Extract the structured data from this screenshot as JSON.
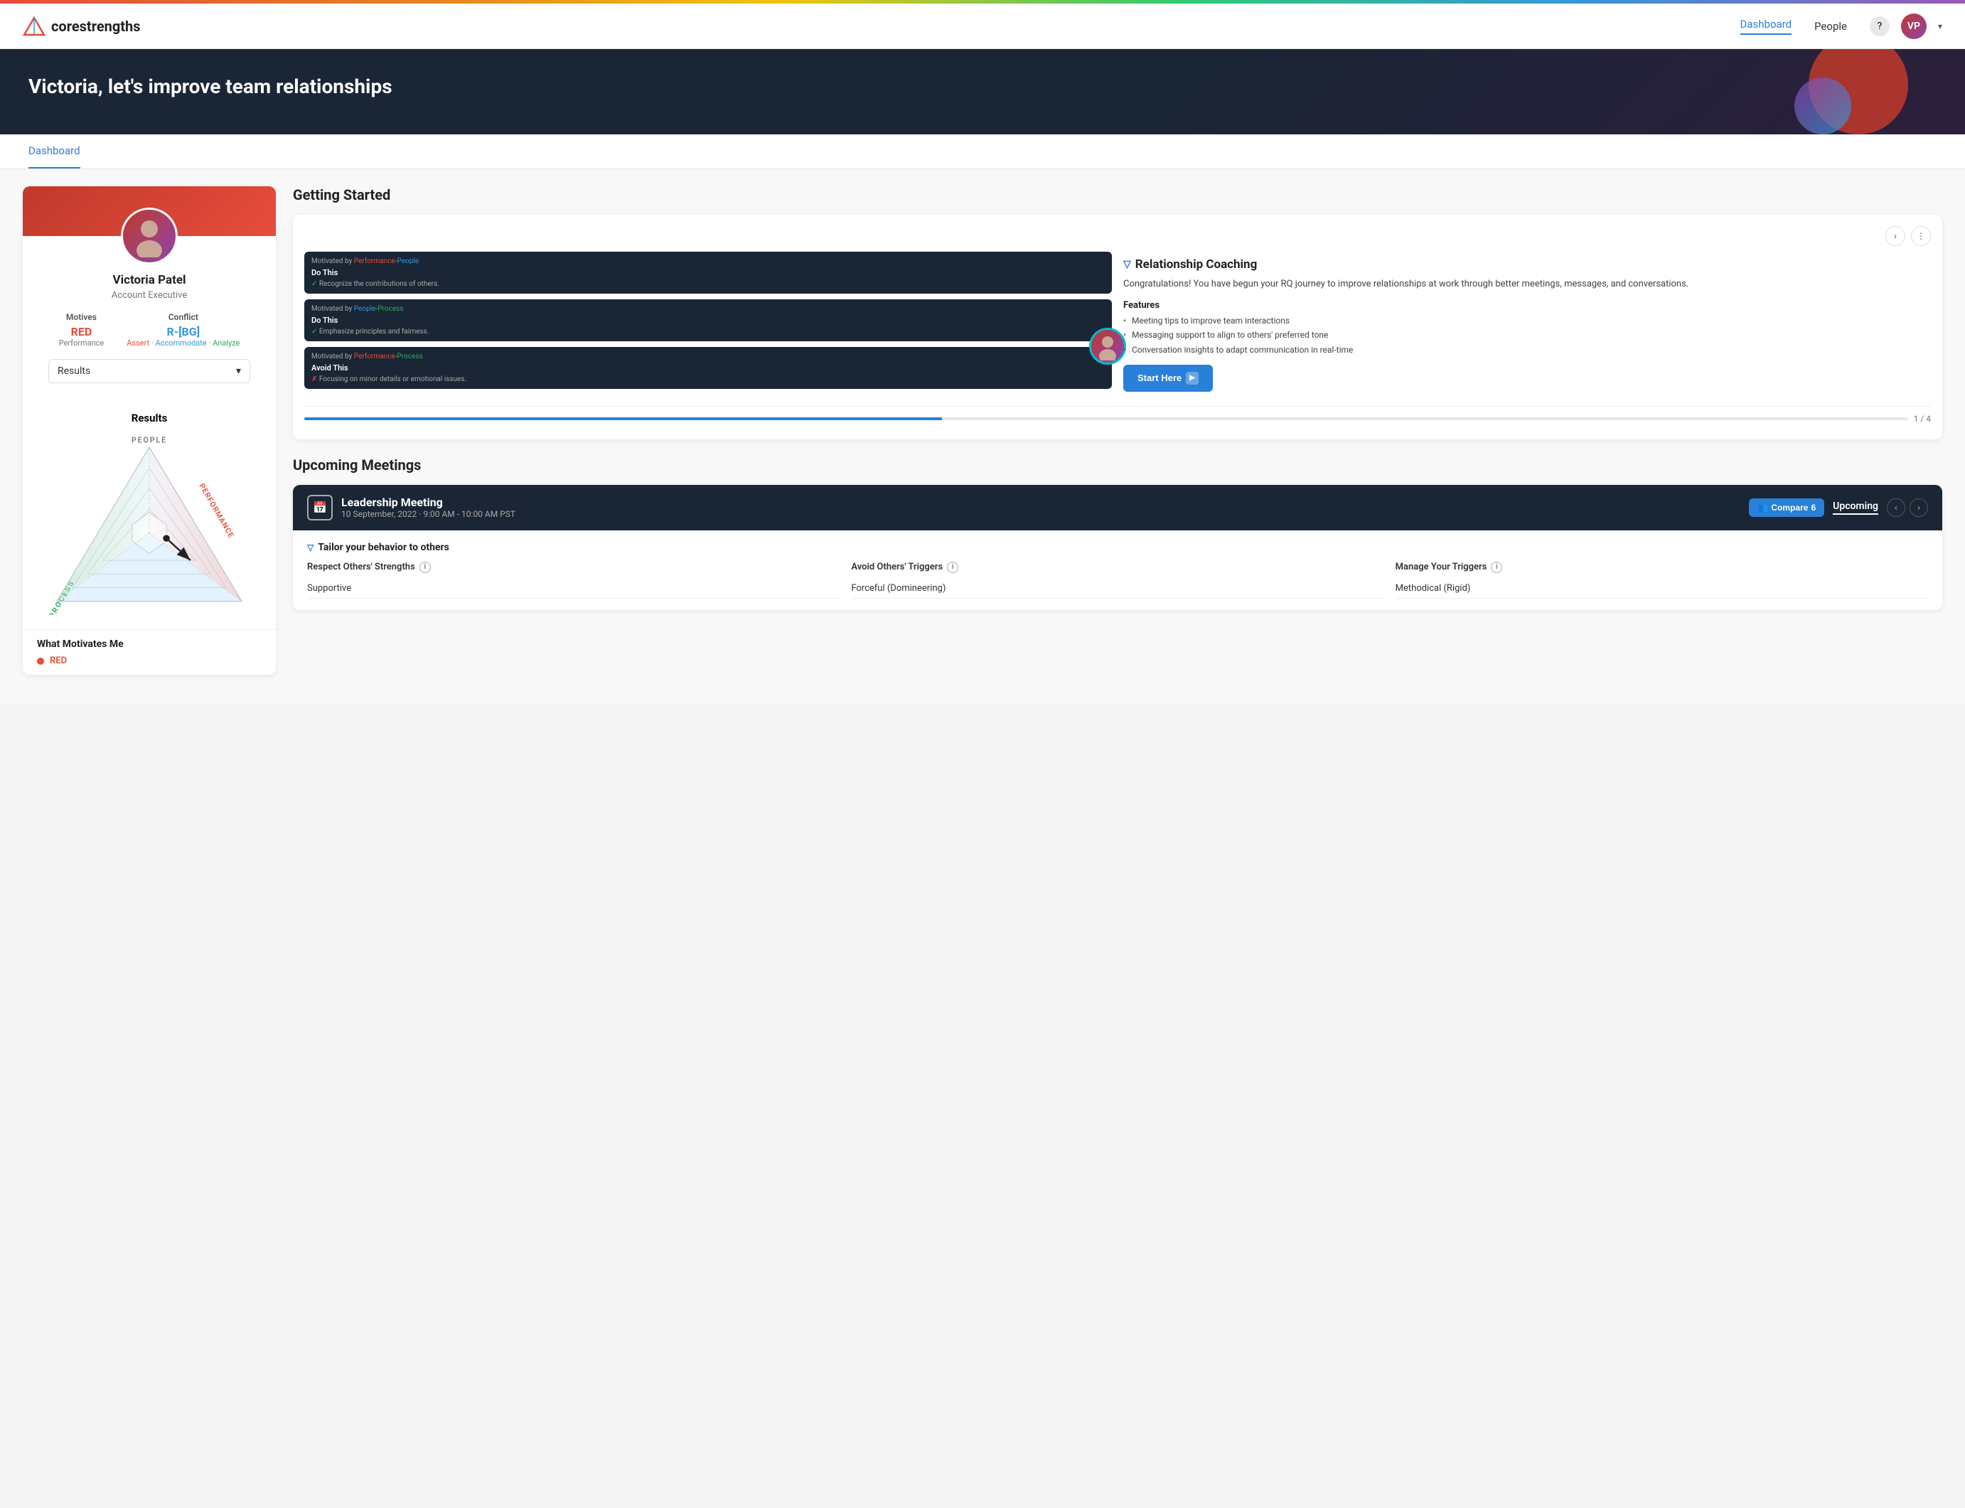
{
  "rainbow": true,
  "navbar": {
    "logo_text_light": "core",
    "logo_text_bold": "strengths",
    "nav_links": [
      {
        "label": "Dashboard",
        "active": true
      },
      {
        "label": "People",
        "active": false
      }
    ],
    "avatar_initials": "VP"
  },
  "banner": {
    "title": "Victoria, let's improve team relationships"
  },
  "tab": {
    "label": "Dashboard"
  },
  "profile": {
    "name": "Victoria Patel",
    "title": "Account Executive",
    "motives_label": "Motives",
    "motives_value": "RED",
    "motives_sub": "Performance",
    "conflict_label": "Conflict",
    "conflict_value": "R-[BG]",
    "conflict_sub_assert": "Assert",
    "conflict_sub_accommodate": "Accommodate",
    "conflict_sub_analyze": "Analyze",
    "dropdown_label": "Results",
    "chart_title": "Results"
  },
  "what_motivates": {
    "title": "What Motivates Me",
    "item": "RED"
  },
  "getting_started": {
    "title": "Getting Started",
    "nav_next": "›",
    "nav_dots": "⋮",
    "coaching_title": "Relationship Coaching",
    "coaching_desc": "Congratulations!  You have begun your RQ journey to improve relationships at work through better meetings, messages, and conversations.",
    "features_title": "Features",
    "features": [
      "Meeting tips to improve team interactions",
      "Messaging support to align to others' preferred tone",
      "Conversation insights to adapt communication in real-time"
    ],
    "start_btn": "Start Here",
    "mini_cards": [
      {
        "motivated_by": "Performance-People",
        "action": "Do This",
        "check_text": "Recognize the contributions of others."
      },
      {
        "motivated_by": "People-Process",
        "action": "Do This",
        "check_text": "Emphasize principles and fairness."
      },
      {
        "motivated_by": "Performance-Process",
        "action": "Avoid This",
        "x_text": "Focusing on minor details or emotional issues."
      }
    ],
    "progress": "1 / 4"
  },
  "upcoming": {
    "section_title": "Upcoming Meetings",
    "meeting": {
      "title": "Leadership Meeting",
      "time": "10 September, 2022 · 9:00 AM - 10:00 AM PST",
      "compare_label": "Compare",
      "compare_count": "6",
      "upcoming_tab": "Upcoming",
      "tailor_heading": "Tailor your behavior to others",
      "col1_title": "Respect Others' Strengths",
      "col2_title": "Avoid Others' Triggers",
      "col3_title": "Manage Your Triggers",
      "col1_item": "Supportive",
      "col2_item": "Forceful (Domineering)",
      "col3_item": "Methodical (Rigid)"
    }
  }
}
